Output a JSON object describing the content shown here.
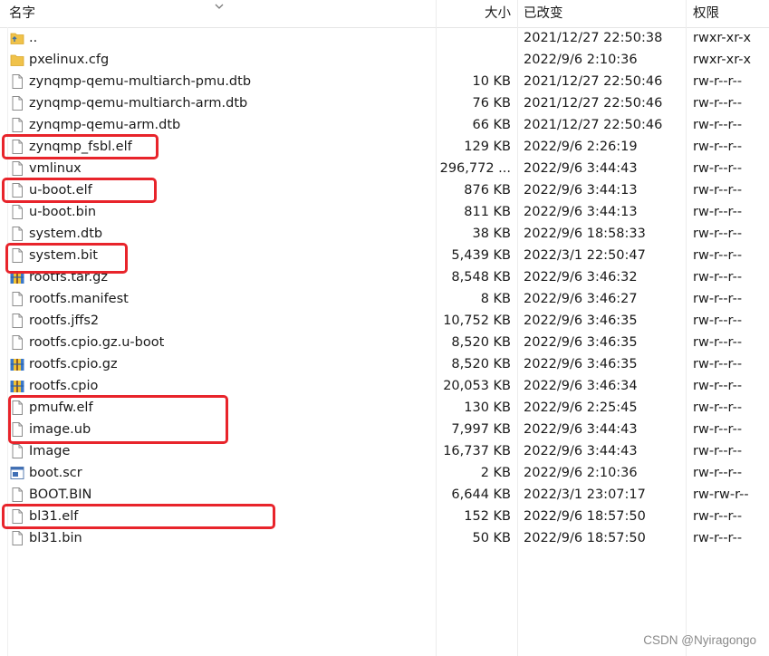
{
  "columns": {
    "name": "名字",
    "size": "大小",
    "modified": "已改变",
    "permissions": "权限"
  },
  "files": [
    {
      "name": "..",
      "size": "",
      "modified": "2021/12/27 22:50:38",
      "permissions": "rwxr-xr-x",
      "icon": "parent-folder-icon",
      "highlighted": false
    },
    {
      "name": "pxelinux.cfg",
      "size": "",
      "modified": "2022/9/6 2:10:36",
      "permissions": "rwxr-xr-x",
      "icon": "folder-icon",
      "highlighted": false
    },
    {
      "name": "zynqmp-qemu-multiarch-pmu.dtb",
      "size": "10 KB",
      "modified": "2021/12/27 22:50:46",
      "permissions": "rw-r--r--",
      "icon": "file-icon",
      "highlighted": false
    },
    {
      "name": "zynqmp-qemu-multiarch-arm.dtb",
      "size": "76 KB",
      "modified": "2021/12/27 22:50:46",
      "permissions": "rw-r--r--",
      "icon": "file-icon",
      "highlighted": false
    },
    {
      "name": "zynqmp-qemu-arm.dtb",
      "size": "66 KB",
      "modified": "2021/12/27 22:50:46",
      "permissions": "rw-r--r--",
      "icon": "file-icon",
      "highlighted": false
    },
    {
      "name": "zynqmp_fsbl.elf",
      "size": "129 KB",
      "modified": "2022/9/6 2:26:19",
      "permissions": "rw-r--r--",
      "icon": "file-icon",
      "highlighted": true
    },
    {
      "name": "vmlinux",
      "size": "296,772 ...",
      "modified": "2022/9/6 3:44:43",
      "permissions": "rw-r--r--",
      "icon": "file-icon",
      "highlighted": false
    },
    {
      "name": "u-boot.elf",
      "size": "876 KB",
      "modified": "2022/9/6 3:44:13",
      "permissions": "rw-r--r--",
      "icon": "file-icon",
      "highlighted": true
    },
    {
      "name": "u-boot.bin",
      "size": "811 KB",
      "modified": "2022/9/6 3:44:13",
      "permissions": "rw-r--r--",
      "icon": "file-icon",
      "highlighted": false
    },
    {
      "name": "system.dtb",
      "size": "38 KB",
      "modified": "2022/9/6 18:58:33",
      "permissions": "rw-r--r--",
      "icon": "file-icon",
      "highlighted": false
    },
    {
      "name": "system.bit",
      "size": "5,439 KB",
      "modified": "2022/3/1 22:50:47",
      "permissions": "rw-r--r--",
      "icon": "file-icon",
      "highlighted": true
    },
    {
      "name": "rootfs.tar.gz",
      "size": "8,548 KB",
      "modified": "2022/9/6 3:46:32",
      "permissions": "rw-r--r--",
      "icon": "archive-icon",
      "highlighted": false
    },
    {
      "name": "rootfs.manifest",
      "size": "8 KB",
      "modified": "2022/9/6 3:46:27",
      "permissions": "rw-r--r--",
      "icon": "file-icon",
      "highlighted": false
    },
    {
      "name": "rootfs.jffs2",
      "size": "10,752 KB",
      "modified": "2022/9/6 3:46:35",
      "permissions": "rw-r--r--",
      "icon": "file-icon",
      "highlighted": false
    },
    {
      "name": "rootfs.cpio.gz.u-boot",
      "size": "8,520 KB",
      "modified": "2022/9/6 3:46:35",
      "permissions": "rw-r--r--",
      "icon": "file-icon",
      "highlighted": false
    },
    {
      "name": "rootfs.cpio.gz",
      "size": "8,520 KB",
      "modified": "2022/9/6 3:46:35",
      "permissions": "rw-r--r--",
      "icon": "archive-icon",
      "highlighted": false
    },
    {
      "name": "rootfs.cpio",
      "size": "20,053 KB",
      "modified": "2022/9/6 3:46:34",
      "permissions": "rw-r--r--",
      "icon": "archive-icon",
      "highlighted": false
    },
    {
      "name": "pmufw.elf",
      "size": "130 KB",
      "modified": "2022/9/6 2:25:45",
      "permissions": "rw-r--r--",
      "icon": "file-icon",
      "highlighted": true
    },
    {
      "name": "image.ub",
      "size": "7,997 KB",
      "modified": "2022/9/6 3:44:43",
      "permissions": "rw-r--r--",
      "icon": "file-icon",
      "highlighted": true
    },
    {
      "name": "Image",
      "size": "16,737 KB",
      "modified": "2022/9/6 3:44:43",
      "permissions": "rw-r--r--",
      "icon": "file-icon",
      "highlighted": false
    },
    {
      "name": "boot.scr",
      "size": "2 KB",
      "modified": "2022/9/6 2:10:36",
      "permissions": "rw-r--r--",
      "icon": "script-icon",
      "highlighted": false
    },
    {
      "name": "BOOT.BIN",
      "size": "6,644 KB",
      "modified": "2022/3/1 23:07:17",
      "permissions": "rw-rw-r--",
      "icon": "file-icon",
      "highlighted": false
    },
    {
      "name": "bl31.elf",
      "size": "152 KB",
      "modified": "2022/9/6 18:57:50",
      "permissions": "rw-r--r--",
      "icon": "file-icon",
      "highlighted": true
    },
    {
      "name": "bl31.bin",
      "size": "50 KB",
      "modified": "2022/9/6 18:57:50",
      "permissions": "rw-r--r--",
      "icon": "file-icon",
      "highlighted": false
    }
  ],
  "watermark": "CSDN @Nyiragongo",
  "colors": {
    "highlight": "#e8242b",
    "folder": "#f0c24a"
  }
}
